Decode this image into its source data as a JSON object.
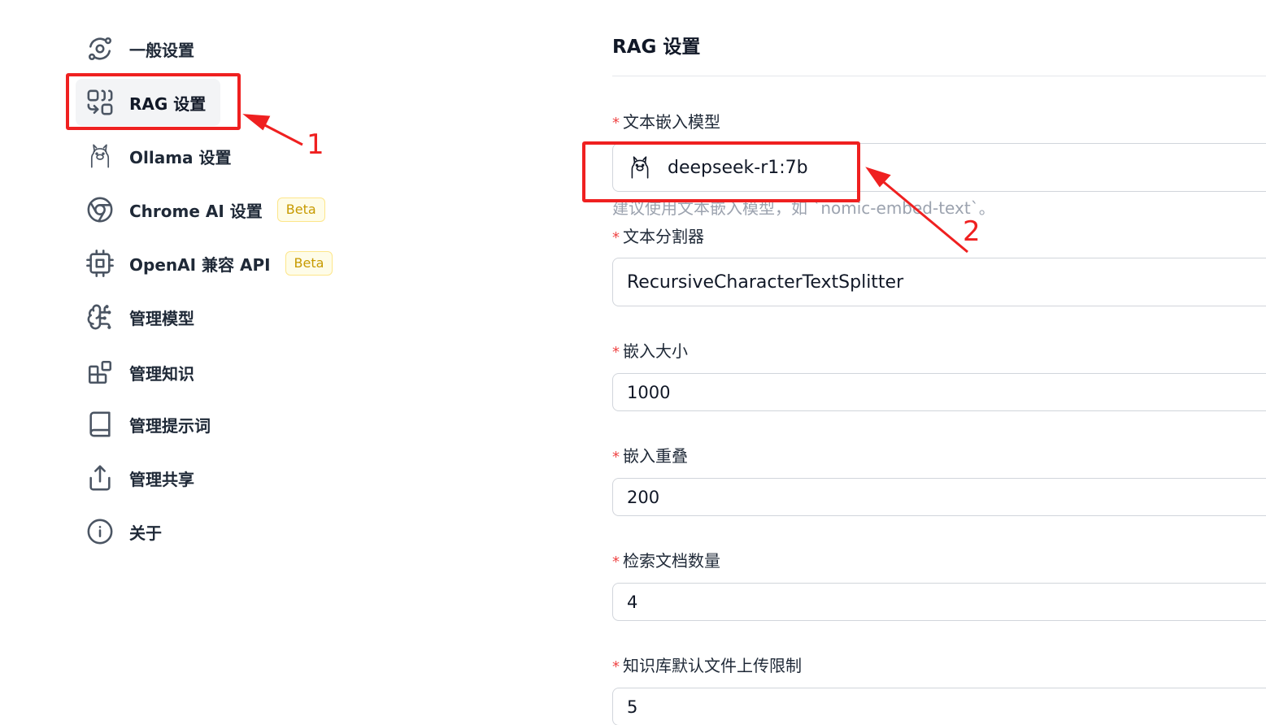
{
  "sidebar": {
    "items": [
      {
        "label": "一般设置",
        "icon": "orbit-settings-icon"
      },
      {
        "label": "RAG 设置",
        "icon": "combine-icon",
        "active": true
      },
      {
        "label": "Ollama 设置",
        "icon": "llama-icon"
      },
      {
        "label": "Chrome AI 设置",
        "icon": "chrome-icon",
        "badge": "Beta"
      },
      {
        "label": "OpenAI 兼容 API",
        "icon": "cpu-icon",
        "badge": "Beta"
      },
      {
        "label": "管理模型",
        "icon": "brain-icon"
      },
      {
        "label": "管理知识",
        "icon": "blocks-icon"
      },
      {
        "label": "管理提示词",
        "icon": "book-icon"
      },
      {
        "label": "管理共享",
        "icon": "share-icon"
      },
      {
        "label": "关于",
        "icon": "info-icon"
      }
    ]
  },
  "main": {
    "title": "RAG 设置",
    "required_mark": "*",
    "fields": {
      "embedding_model": {
        "label": "文本嵌入模型",
        "value": "deepseek-r1:7b",
        "help": "建议使用文本嵌入模型，如 `nomic-embed-text`。"
      },
      "splitter": {
        "label": "文本分割器",
        "value": "RecursiveCharacterTextSplitter"
      },
      "chunk_size": {
        "label": "嵌入大小",
        "value": "1000"
      },
      "chunk_overlap": {
        "label": "嵌入重叠",
        "value": "200"
      },
      "doc_count": {
        "label": "检索文档数量",
        "value": "4"
      },
      "upload_limit": {
        "label": "知识库默认文件上传限制",
        "value": "5"
      }
    }
  },
  "annotations": {
    "marker_1": "1",
    "marker_2": "2",
    "color": "#ef2020"
  },
  "colors": {
    "badge_text": "#c79a00",
    "badge_bg": "#fefce8",
    "required": "#ef4444",
    "active_bg": "#f3f4f6"
  }
}
